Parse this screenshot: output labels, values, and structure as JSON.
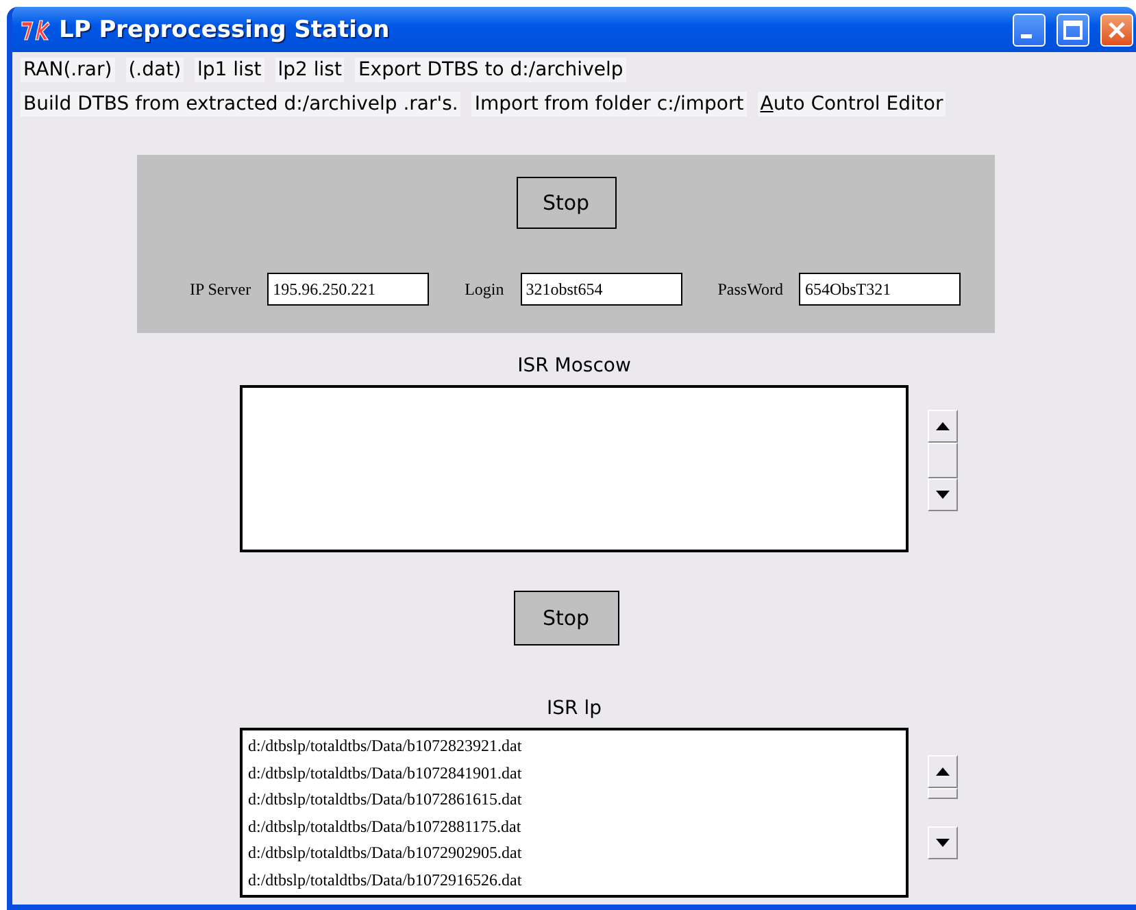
{
  "window": {
    "title": "LP Preprocessing Station"
  },
  "menu_rows": [
    [
      {
        "label": "RAN(.rar)",
        "underline_first": false
      },
      {
        "label": "(.dat)",
        "underline_first": false
      },
      {
        "label": "lp1 list",
        "underline_first": false
      },
      {
        "label": "lp2 list",
        "underline_first": false
      },
      {
        "label": "Export DTBS to d:/archivelp",
        "underline_first": false
      }
    ],
    [
      {
        "label": "Build DTBS from extracted d:/archivelp .rar's.",
        "underline_first": false
      },
      {
        "label": "Import from folder c:/import",
        "underline_first": false
      },
      {
        "label": "Auto Control Editor",
        "underline_first": true
      }
    ]
  ],
  "connection": {
    "stop_button": "Stop",
    "fields": [
      {
        "label": "IP Server",
        "value": "195.96.250.221"
      },
      {
        "label": "Login",
        "value": "321obst654"
      },
      {
        "label": "PassWord",
        "value": "654ObsT321"
      }
    ]
  },
  "moscow": {
    "title": "ISR Moscow",
    "stop_button": "Stop"
  },
  "lp": {
    "title": "ISR lp",
    "lines": [
      "d:/dtbslp/totaldtbs/Data/b1072823921.dat",
      "d:/dtbslp/totaldtbs/Data/b1072841901.dat",
      "d:/dtbslp/totaldtbs/Data/b1072861615.dat",
      "d:/dtbslp/totaldtbs/Data/b1072881175.dat",
      "d:/dtbslp/totaldtbs/Data/b1072902905.dat",
      "d:/dtbslp/totaldtbs/Data/b1072916526.dat"
    ]
  }
}
